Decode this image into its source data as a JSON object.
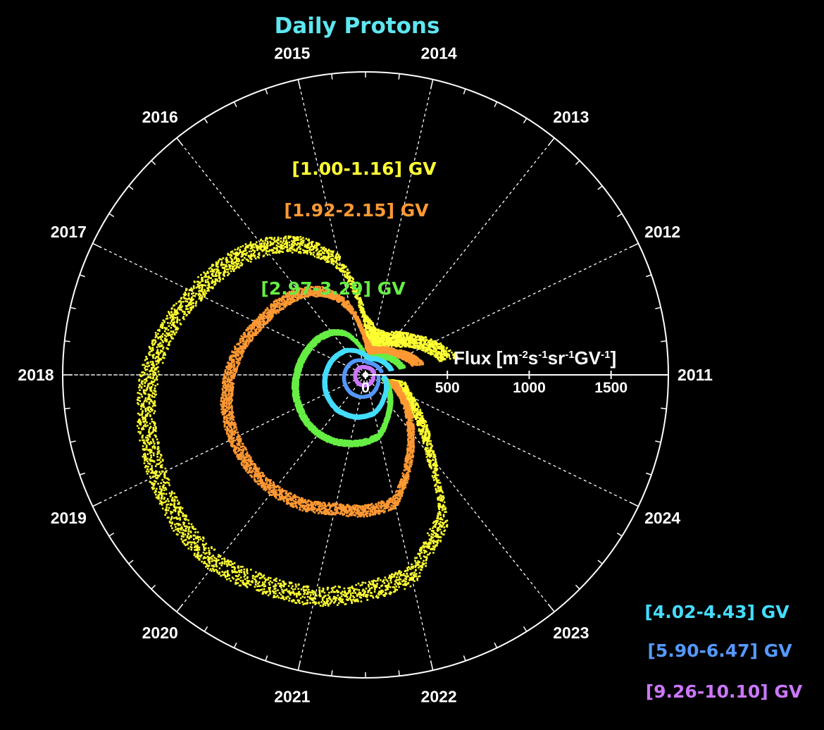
{
  "chart_data": {
    "type": "scatter",
    "title": "Daily Protons",
    "projection": "polar",
    "angle_note": "one turn = 14 years (2011-2024), year 2011 at 0 angle, counter-clockwise",
    "radial_axis": {
      "label": "Flux [m-2s-1sr-1GV-1]",
      "label_parts": [
        "Flux [m",
        "-2",
        "s",
        "-1",
        "sr",
        "-1",
        "GV",
        "-1",
        "]"
      ],
      "ticks": [
        0,
        500,
        1000,
        1500
      ],
      "tick_labels": [
        "0",
        "500",
        "1000",
        "1500"
      ],
      "range": [
        0,
        1850
      ]
    },
    "year_labels": [
      "2011",
      "2012",
      "2013",
      "2014",
      "2015",
      "2016",
      "2017",
      "2018",
      "2019",
      "2020",
      "2021",
      "2022",
      "2023",
      "2024"
    ],
    "year_start": 2011,
    "year_end": 2024.9,
    "series": [
      {
        "name": "[1.00-1.16] GV",
        "color": "#ffff33",
        "x": [
          2011.4,
          2011.7,
          2012.0,
          2012.5,
          2013.0,
          2013.5,
          2014.0,
          2014.5,
          2015.0,
          2015.5,
          2016.0,
          2016.5,
          2017.0,
          2017.5,
          2018.0,
          2018.5,
          2019.0,
          2019.5,
          2020.0,
          2020.5,
          2021.0,
          2021.5,
          2022.0,
          2022.3,
          2022.6,
          2022.9,
          2023.2,
          2023.5,
          2023.8,
          2024.2,
          2024.6
        ],
        "y": [
          520,
          470,
          420,
          330,
          280,
          230,
          230,
          310,
          700,
          880,
          1000,
          1080,
          1150,
          1240,
          1320,
          1370,
          1410,
          1450,
          1470,
          1420,
          1390,
          1320,
          1260,
          1110,
          1000,
          700,
          530,
          420,
          320,
          230,
          190
        ]
      },
      {
        "name": "[1.92-2.15] GV",
        "color": "#ff9933",
        "x": [
          2011.4,
          2011.7,
          2012.0,
          2012.5,
          2013.0,
          2013.5,
          2014.0,
          2014.5,
          2015.0,
          2015.5,
          2016.0,
          2016.5,
          2017.0,
          2017.5,
          2018.0,
          2018.5,
          2019.0,
          2019.5,
          2020.0,
          2020.5,
          2021.0,
          2021.5,
          2022.0,
          2022.5,
          2023.0,
          2023.5,
          2024.0,
          2024.5
        ],
        "y": [
          330,
          300,
          270,
          210,
          180,
          150,
          140,
          200,
          420,
          560,
          640,
          680,
          720,
          780,
          830,
          870,
          890,
          900,
          900,
          880,
          840,
          830,
          800,
          600,
          440,
          320,
          220,
          160
        ]
      },
      {
        "name": "[2.97-3.29] GV",
        "color": "#66ee44",
        "x": [
          2011.4,
          2012.0,
          2012.5,
          2013.0,
          2013.5,
          2014.0,
          2014.5,
          2015.0,
          2015.5,
          2016.0,
          2016.5,
          2017.0,
          2017.5,
          2018.0,
          2018.5,
          2019.0,
          2019.5,
          2020.0,
          2020.5,
          2021.0,
          2021.5,
          2022.0,
          2022.5,
          2023.0,
          2023.5,
          2024.0,
          2024.5
        ],
        "y": [
          230,
          200,
          170,
          140,
          115,
          100,
          110,
          190,
          280,
          330,
          360,
          380,
          400,
          420,
          440,
          450,
          460,
          460,
          450,
          430,
          410,
          380,
          300,
          240,
          190,
          150,
          120
        ]
      },
      {
        "name": "[4.02-4.43] GV",
        "color": "#44ddff",
        "x": [
          2011.4,
          2012.0,
          2013.0,
          2014.0,
          2015.0,
          2016.0,
          2017.0,
          2018.0,
          2019.0,
          2020.0,
          2021.0,
          2022.0,
          2023.0,
          2024.0,
          2024.8
        ],
        "y": [
          160,
          145,
          120,
          100,
          140,
          190,
          220,
          245,
          265,
          275,
          265,
          240,
          180,
          140,
          115
        ]
      },
      {
        "name": "[5.90-6.47] GV",
        "color": "#5599ff",
        "x": [
          2011.4,
          2012.0,
          2013.0,
          2014.0,
          2015.0,
          2016.0,
          2017.0,
          2018.0,
          2019.0,
          2020.0,
          2021.0,
          2022.0,
          2023.0,
          2024.0,
          2024.8
        ],
        "y": [
          100,
          92,
          82,
          75,
          90,
          108,
          120,
          130,
          138,
          142,
          138,
          128,
          105,
          88,
          78
        ]
      },
      {
        "name": "[9.26-10.10] GV",
        "color": "#cc77ff",
        "x": [
          2011.4,
          2012.0,
          2013.0,
          2014.0,
          2015.0,
          2016.0,
          2017.0,
          2018.0,
          2019.0,
          2020.0,
          2021.0,
          2022.0,
          2023.0,
          2024.0,
          2024.8
        ],
        "y": [
          55,
          52,
          48,
          45,
          50,
          56,
          60,
          63,
          66,
          68,
          66,
          63,
          57,
          52,
          48
        ]
      }
    ]
  }
}
